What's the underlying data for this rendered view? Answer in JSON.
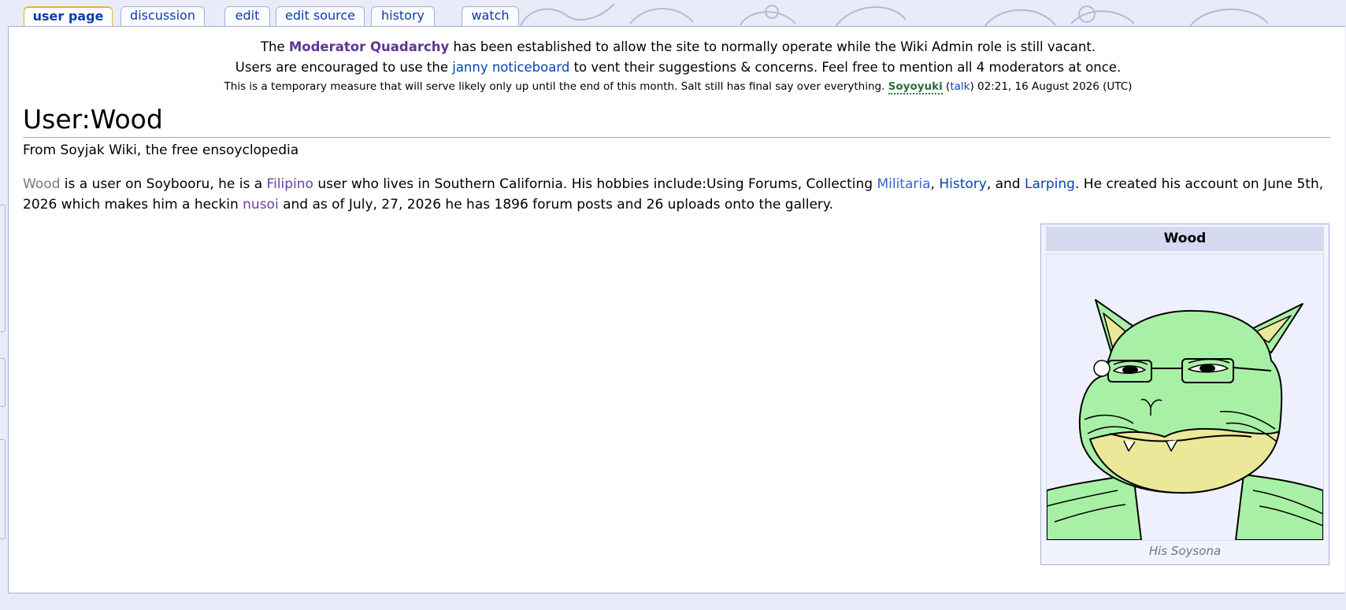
{
  "tabs": [
    {
      "label": "user page",
      "selected": true
    },
    {
      "label": "discussion"
    },
    {
      "label": "edit"
    },
    {
      "label": "edit source"
    },
    {
      "label": "history"
    },
    {
      "label": "watch"
    }
  ],
  "sitenotice": {
    "line1": {
      "pre": "The ",
      "link": "Moderator Quadarchy",
      "post": " has been established to allow the site to normally operate while the Wiki Admin role is still vacant."
    },
    "line2": {
      "pre": "Users are encouraged to use the ",
      "link": "janny noticeboard",
      "post": " to vent their suggestions & concerns. Feel free to mention all 4 moderators at once."
    },
    "line3": {
      "text": "This is a temporary measure that will serve likely only up until the end of this month. Salt still has final say over everything. ",
      "sig_name": "Soyoyuki",
      "talk_open": " (",
      "talk_link": "talk",
      "talk_close": ") ",
      "timestamp": "02:21, 16 August 2026 (UTC)"
    }
  },
  "page": {
    "title": "User:Wood",
    "tagline": "From Soyjak Wiki, the free ensoyclopedia",
    "body": {
      "wood": "Wood",
      "t1": " is a user on Soybooru, he is a ",
      "filipino": "Filipino",
      "t2": " user who lives in Southern California. His hobbies include:Using Forums, Collecting ",
      "militaria": "Militaria",
      "t3": ", ",
      "history": "History",
      "t4": ", and ",
      "larping": "Larping",
      "t5": ". He created his account on June 5th, 2026 which makes him a heckin ",
      "nusoi": "nusoi",
      "t6": " and as of July, 27, 2026 he has 1896 forum posts and 26 uploads onto the gallery."
    }
  },
  "infobox": {
    "title": "Wood",
    "caption": "His Soysona"
  },
  "colors": {
    "link": "#0645ad",
    "visited": "#6b3fa0",
    "infobox_header": "#d5daf1",
    "skin_green": "#a8f0a6",
    "skin_yellow": "#ece89a"
  }
}
